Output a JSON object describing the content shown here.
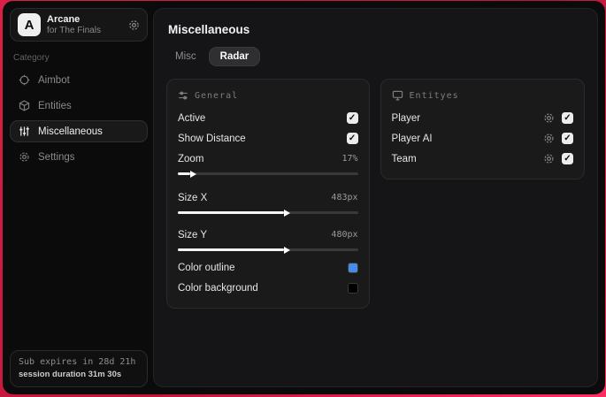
{
  "app": {
    "name": "Arcane",
    "subtitle": "for The Finals",
    "logo_letter": "A"
  },
  "sidebar": {
    "category_label": "Category",
    "nav": [
      {
        "label": "Aimbot",
        "icon": "crosshair-icon"
      },
      {
        "label": "Entities",
        "icon": "cube-icon"
      },
      {
        "label": "Miscellaneous",
        "icon": "sliders-vertical-icon"
      },
      {
        "label": "Settings",
        "icon": "gear-icon"
      }
    ],
    "footer": {
      "sub_expires": "Sub expires in 28d 21h",
      "session_duration": "session duration 31m 30s"
    }
  },
  "main": {
    "title": "Miscellaneous",
    "tabs": [
      {
        "label": "Misc",
        "active": false
      },
      {
        "label": "Radar",
        "active": true
      }
    ],
    "panels": {
      "general": {
        "title": "General",
        "rows": {
          "active": {
            "label": "Active",
            "checked": true
          },
          "show_distance": {
            "label": "Show Distance",
            "checked": true
          },
          "zoom": {
            "label": "Zoom",
            "value": "17%",
            "fill_pct": 7
          },
          "size_x": {
            "label": "Size X",
            "value": "483px",
            "fill_pct": 59
          },
          "size_y": {
            "label": "Size Y",
            "value": "480px",
            "fill_pct": 59
          },
          "color_outline": {
            "label": "Color outline",
            "swatch": "#4a8be4"
          },
          "color_background": {
            "label": "Color background",
            "swatch": "#000000"
          }
        }
      },
      "entities": {
        "title": "Entityes",
        "rows": [
          {
            "label": "Player",
            "checked": true
          },
          {
            "label": "Player AI",
            "checked": true
          },
          {
            "label": "Team",
            "checked": true
          }
        ]
      }
    }
  },
  "colors": {
    "accent_blue": "#4a8be4",
    "background_red": "#d92046"
  },
  "glyphs": {
    "check": "✓"
  }
}
